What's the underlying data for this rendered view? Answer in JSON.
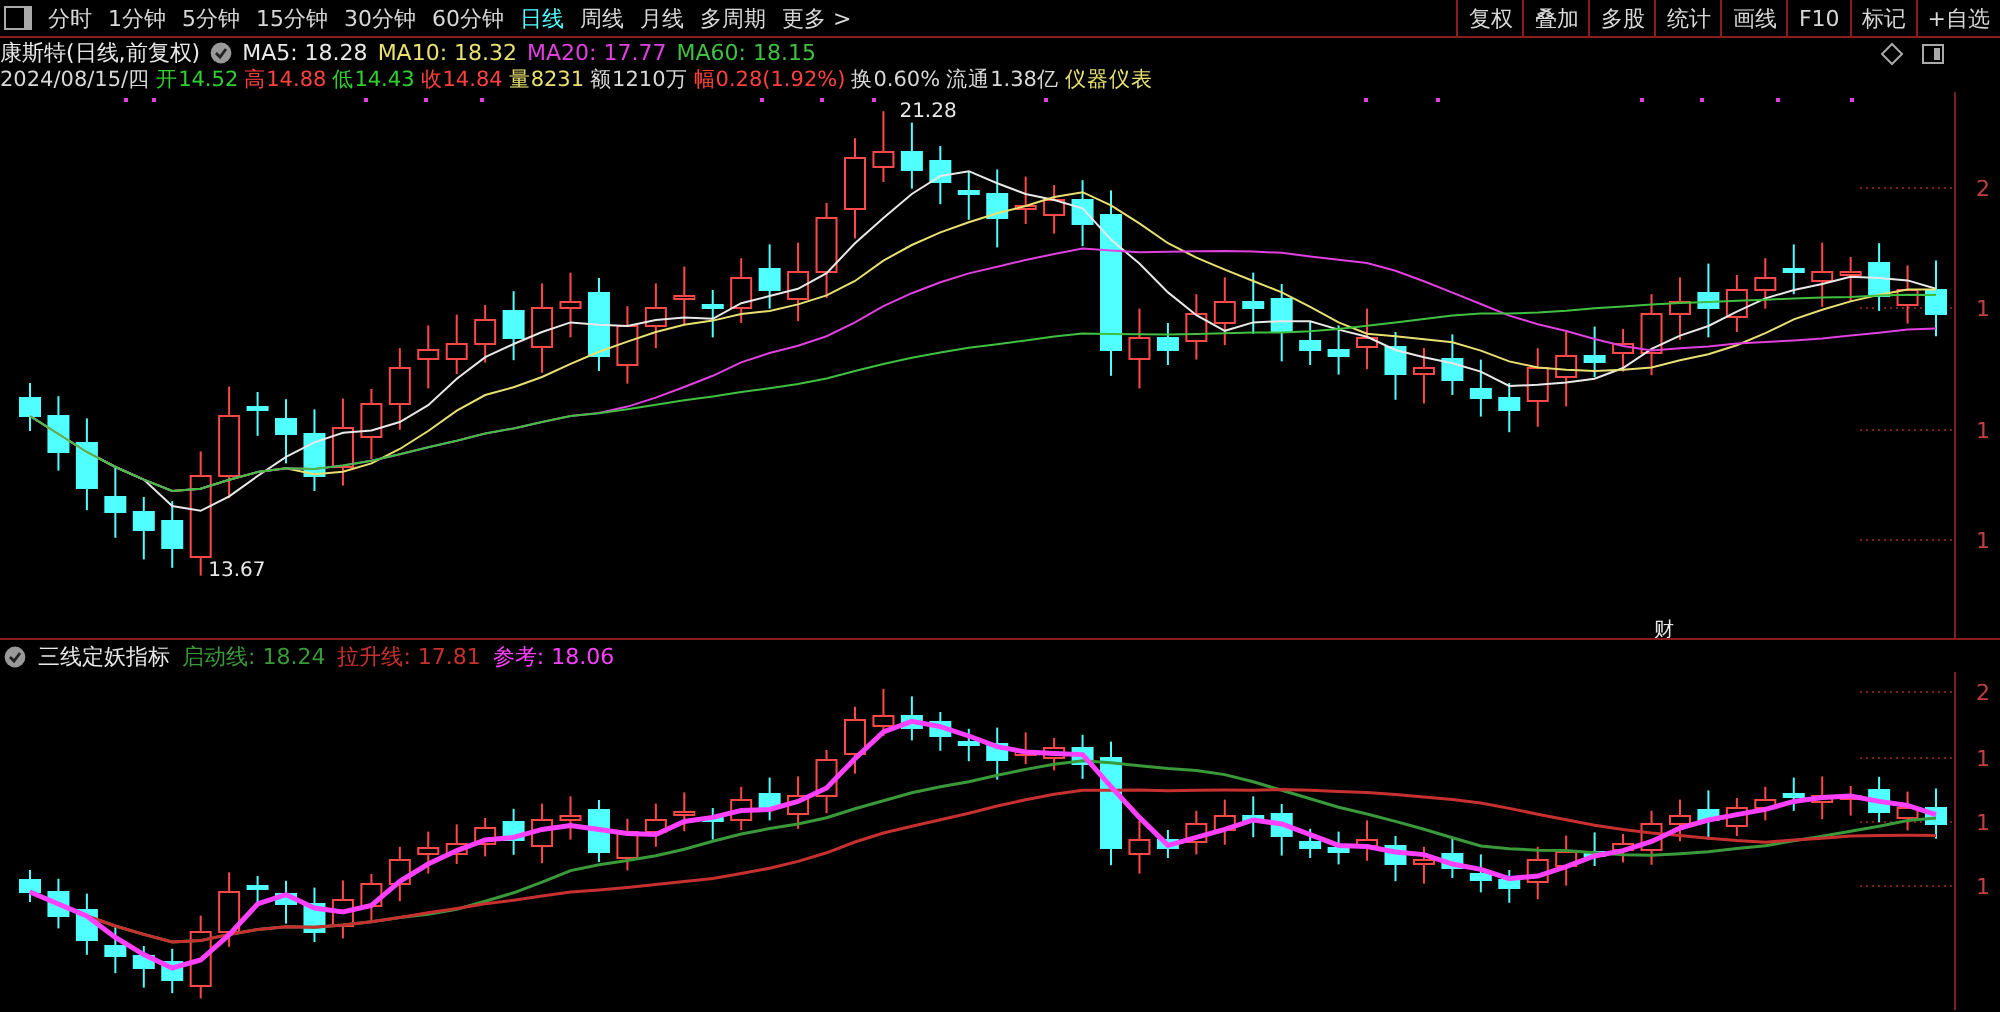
{
  "toolbar": {
    "periods": [
      {
        "label": "分时",
        "selected": false
      },
      {
        "label": "1分钟",
        "selected": false
      },
      {
        "label": "5分钟",
        "selected": false
      },
      {
        "label": "15分钟",
        "selected": false
      },
      {
        "label": "30分钟",
        "selected": false
      },
      {
        "label": "60分钟",
        "selected": false
      },
      {
        "label": "日线",
        "selected": true
      },
      {
        "label": "周线",
        "selected": false
      },
      {
        "label": "月线",
        "selected": false
      },
      {
        "label": "多周期",
        "selected": false
      },
      {
        "label": "更多 >",
        "selected": false
      }
    ],
    "actions": [
      "复权",
      "叠加",
      "多股",
      "统计",
      "画线",
      "F10",
      "标记",
      "+自选"
    ]
  },
  "main_pane": {
    "title": "康斯特(日线,前复权)",
    "moving_averages": [
      {
        "label": "MA5: 18.28",
        "color": "#e8e8e8"
      },
      {
        "label": "MA10: 18.32",
        "color": "#e8e070"
      },
      {
        "label": "MA20: 17.77",
        "color": "#e040e0"
      },
      {
        "label": "MA60: 18.15",
        "color": "#40c040"
      }
    ],
    "quote": [
      {
        "label": "2024/08/15/四",
        "color": "#d8d8d8"
      },
      {
        "label": "开14.52",
        "color": "#30d030"
      },
      {
        "label": "高14.88",
        "color": "#ff4040"
      },
      {
        "label": "低14.43",
        "color": "#30d030"
      },
      {
        "label": "收14.84",
        "color": "#ff4040"
      },
      {
        "label": "量8231",
        "color": "#e8e070"
      },
      {
        "label": "额1210万",
        "color": "#d8d8d8"
      },
      {
        "label": "幅0.28(1.92%)",
        "color": "#ff4040"
      },
      {
        "label": "换0.60%",
        "color": "#d8d8d8"
      },
      {
        "label": "流通1.38亿",
        "color": "#d8d8d8"
      },
      {
        "label": "仪器仪表",
        "color": "#e8e070"
      }
    ],
    "high_label": "21.28",
    "low_label": "13.67",
    "event_marker": "财",
    "axis_labels": [
      "2",
      "1",
      "1",
      "1"
    ]
  },
  "indicator_pane": {
    "name": "三线定妖指标",
    "lines": [
      {
        "label": "启动线: 18.24",
        "color": "#3a9a3a"
      },
      {
        "label": "拉升线: 17.81",
        "color": "#c83030"
      },
      {
        "label": "参考: 18.06",
        "color": "#ff40ff"
      }
    ],
    "axis_labels": [
      "2",
      "1",
      "1",
      "1"
    ]
  }
}
